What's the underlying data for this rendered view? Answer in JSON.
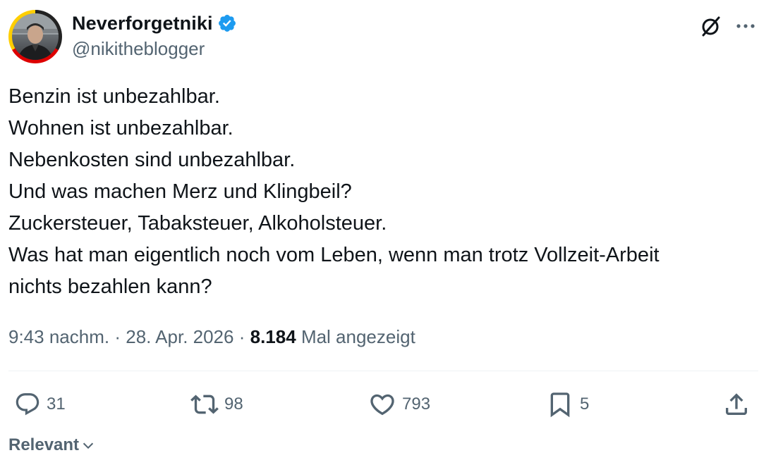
{
  "author": {
    "display_name": "Neverforgetniki",
    "handle": "@nikitheblogger",
    "verified": true
  },
  "tweet": {
    "lines": [
      "Benzin ist unbezahlbar.",
      "Wohnen ist unbezahlbar.",
      "Nebenkosten sind unbezahlbar.",
      "Und was machen Merz und Klingbeil?",
      "Zuckersteuer, Tabaksteuer, Alkoholsteuer.",
      "Was hat man eigentlich noch vom Leben, wenn man trotz Vollzeit-Arbeit",
      "nichts bezahlen kann?"
    ]
  },
  "meta": {
    "time": "9:43 nachm.",
    "separator": "·",
    "date": "28. Apr. 2026",
    "views_count": "8.184",
    "views_label": "Mal angezeigt"
  },
  "actions": {
    "replies": "31",
    "reposts": "98",
    "likes": "793",
    "bookmarks": "5"
  },
  "sort": {
    "label": "Relevant"
  },
  "icons": {
    "grok": "grok-icon",
    "more": "more-icon",
    "reply": "reply-icon",
    "repost": "repost-icon",
    "like": "heart-icon",
    "bookmark": "bookmark-icon",
    "share": "share-icon",
    "verified": "verified-badge-icon",
    "sort_chevron": "chevron-down-icon"
  },
  "colors": {
    "text_primary": "#0f1419",
    "text_secondary": "#536471",
    "verified_blue": "#1d9bf0",
    "divider": "#eff3f4",
    "avatar_ring": [
      "#222222",
      "#dd0000",
      "#ffce00"
    ]
  }
}
